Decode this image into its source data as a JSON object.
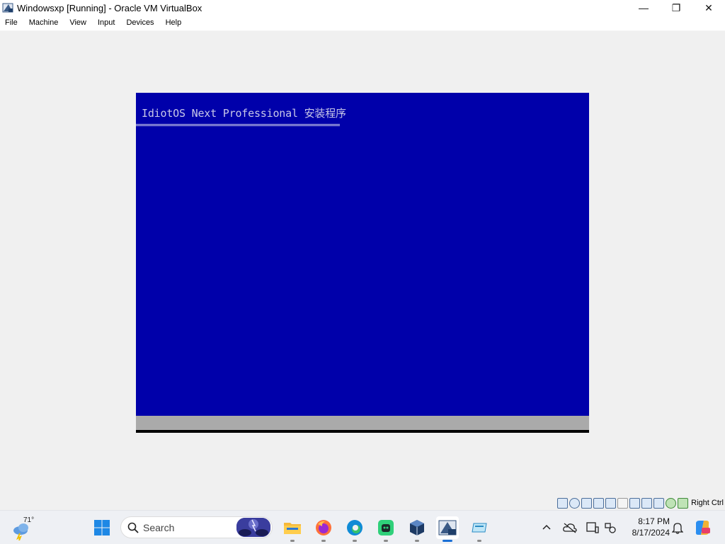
{
  "window": {
    "title": "Windowsxp [Running] - Oracle VM VirtualBox",
    "minimize_glyph": "—",
    "maximize_glyph": "❐",
    "close_glyph": "✕"
  },
  "menu": {
    "items": [
      "File",
      "Machine",
      "View",
      "Input",
      "Devices",
      "Help"
    ]
  },
  "vm": {
    "setup_title": "IdiotOS Next Professional 安装程序",
    "status_line": "",
    "colors": {
      "background": "#0000aa",
      "text": "#c8c8e8",
      "status_bar": "#aaaaaa"
    }
  },
  "vbox_status": {
    "icons": [
      "hard-disk-icon",
      "optical-drive-icon",
      "audio-icon",
      "network-icon",
      "usb-icon",
      "shared-folders-icon",
      "display-icon",
      "video-capture-icon",
      "cpu-icon",
      "mouse-integration-icon",
      "keyboard-icon"
    ],
    "host_key": "Right Ctrl"
  },
  "taskbar": {
    "weather_temp": "71°",
    "search_label": "Search",
    "apps": [
      "file-explorer-icon",
      "firefox-icon",
      "edge-icon",
      "app-icon",
      "virtualbox-icon",
      "windowsxp-vm-icon",
      "storage-app-icon"
    ],
    "clock_time": "8:17 PM",
    "clock_date": "8/17/2024"
  }
}
